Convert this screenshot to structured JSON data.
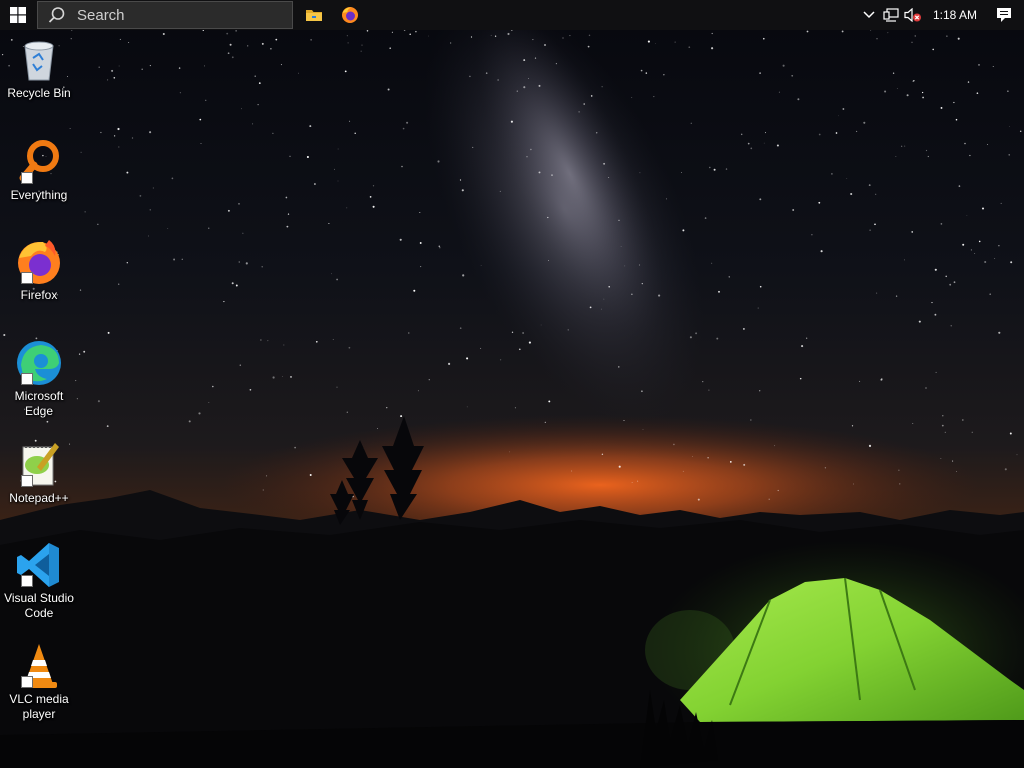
{
  "taskbar": {
    "search_placeholder": "Search",
    "pinned": [
      {
        "name": "File Explorer",
        "icon": "folder-icon"
      },
      {
        "name": "Firefox",
        "icon": "firefox-icon"
      }
    ],
    "tray": {
      "clock": "1:18 AM",
      "icons": [
        "chevron-up-icon",
        "network-icon",
        "volume-muted-icon",
        "notification-icon"
      ]
    }
  },
  "desktop": {
    "icons": [
      {
        "label": "Recycle Bin",
        "icon": "recycle-bin-icon"
      },
      {
        "label": "Everything",
        "icon": "everything-icon"
      },
      {
        "label": "Firefox",
        "icon": "firefox-icon"
      },
      {
        "label": "Microsoft Edge",
        "icon": "edge-icon"
      },
      {
        "label": "Notepad++",
        "icon": "notepadpp-icon"
      },
      {
        "label": "Visual Studio Code",
        "icon": "vscode-icon"
      },
      {
        "label": "VLC media player",
        "icon": "vlc-icon"
      }
    ]
  },
  "colors": {
    "taskbar_bg": "#101012",
    "search_bg": "#2b2b2b",
    "sky_dark": "#07080f",
    "horizon_glow": "#d9571c",
    "tent_green": "#8bd63a"
  }
}
